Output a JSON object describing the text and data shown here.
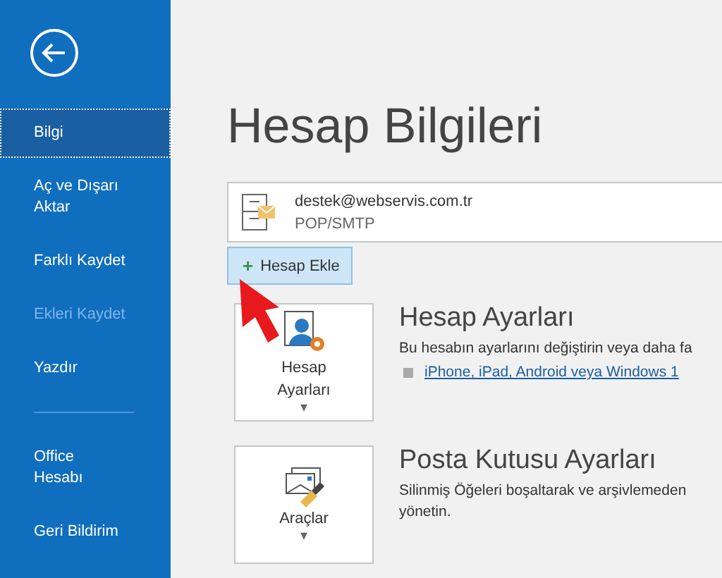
{
  "sidebar": {
    "items": [
      {
        "lines": [
          "Bilgi"
        ],
        "selected": true,
        "disabled": false
      },
      {
        "lines": [
          "Aç ve Dışarı",
          "Aktar"
        ],
        "selected": false,
        "disabled": false
      },
      {
        "lines": [
          "Farklı Kaydet"
        ],
        "selected": false,
        "disabled": false
      },
      {
        "lines": [
          "Ekleri Kaydet"
        ],
        "selected": false,
        "disabled": true
      },
      {
        "lines": [
          "Yazdır"
        ],
        "selected": false,
        "disabled": false
      },
      {
        "lines": [
          "Office",
          "Hesabı"
        ],
        "selected": false,
        "disabled": false,
        "divider_before": true
      },
      {
        "lines": [
          "Geri Bildirim"
        ],
        "selected": false,
        "disabled": false
      }
    ]
  },
  "page_title": "Hesap Bilgileri",
  "account": {
    "email": "destek@webservis.com.tr",
    "type": "POP/SMTP"
  },
  "add_account_button": {
    "icon": "+",
    "label": "Hesap Ekle"
  },
  "sections": [
    {
      "kind": "settings",
      "button_lines": [
        "Hesap",
        "Ayarları"
      ],
      "caret": "▾",
      "title": "Hesap Ayarları",
      "description_lines": [
        "Bu hesabın ayarlarını değiştirin veya daha fa"
      ],
      "link": "iPhone, iPad, Android veya Windows 1"
    },
    {
      "kind": "tools",
      "button_lines": [
        "Araçlar"
      ],
      "caret": "▾",
      "title": "Posta Kutusu Ayarları",
      "description_lines": [
        "Silinmiş Öğeleri boşaltarak ve arşivlemeden",
        "yönetin."
      ]
    }
  ]
}
